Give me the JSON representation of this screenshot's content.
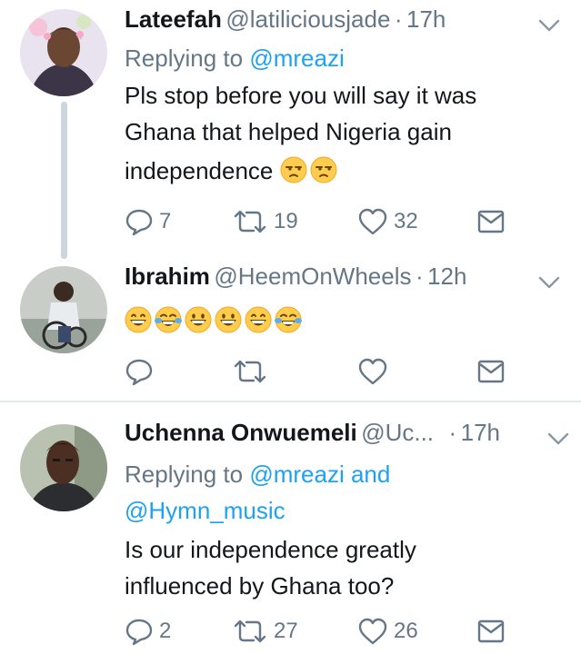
{
  "tweets": [
    {
      "name": "Lateefah",
      "handle": "@latiliciousjade",
      "time": "17h",
      "replying_prefix": "Replying to",
      "replying_to": "@mreazi",
      "text_lines": [
        "Pls stop before you will say it was",
        "Ghana that helped Nigeria gain",
        "independence"
      ],
      "text_emojis": [
        "unamused-face",
        "unamused-face"
      ],
      "replies": "7",
      "retweets": "19",
      "likes": "32"
    },
    {
      "name": "Ibrahim",
      "handle": "@HeemOnWheels",
      "time": "12h",
      "text_emojis": [
        "grinning-face",
        "face-with-tears-of-joy",
        "grinning-face",
        "grinning-face",
        "grinning-face",
        "face-with-tears-of-joy"
      ],
      "replies": "",
      "retweets": "",
      "likes": ""
    },
    {
      "name": "Uchenna Onwuemeli",
      "handle": "@Uc...",
      "time": "17h",
      "replying_prefix": "Replying to",
      "replying_to": "@mreazi and",
      "replying_to_2": "@Hymn_music",
      "text_lines": [
        "Is our independence greatly",
        "influenced by Ghana too?"
      ],
      "replies": "2",
      "retweets": "27",
      "likes": "26"
    }
  ],
  "colors": {
    "link": "#1da1f2",
    "muted": "#657786",
    "text": "#14171a",
    "thread_line": "#cdd6dd"
  }
}
